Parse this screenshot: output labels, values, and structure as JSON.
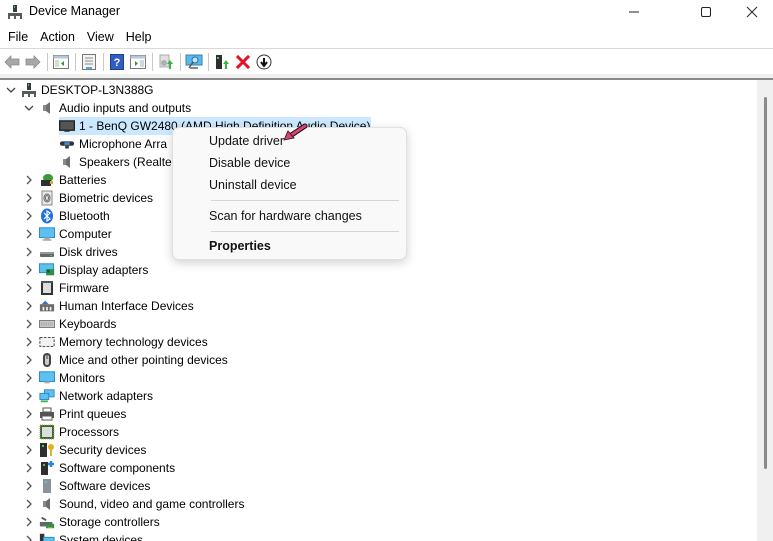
{
  "window": {
    "title": "Device Manager",
    "controls": {
      "minimize": "minimize",
      "maximize": "maximize",
      "close": "close"
    }
  },
  "menubar": {
    "items": [
      "File",
      "Action",
      "View",
      "Help"
    ]
  },
  "toolbar": {
    "buttons": [
      {
        "name": "back",
        "icon": "back-arrow-icon",
        "enabled": false
      },
      {
        "name": "forward",
        "icon": "forward-arrow-icon",
        "enabled": false
      },
      {
        "name": "show-hide-console-tree",
        "icon": "console-tree-icon"
      },
      {
        "name": "properties",
        "icon": "properties-icon"
      },
      {
        "name": "help",
        "icon": "help-icon"
      },
      {
        "name": "show-hide-action-pane",
        "icon": "action-pane-icon"
      },
      {
        "name": "update-driver",
        "icon": "update-driver-icon",
        "enabled": false
      },
      {
        "name": "scan-hardware",
        "icon": "scan-monitor-icon"
      },
      {
        "name": "enable-device",
        "icon": "enable-device-icon"
      },
      {
        "name": "uninstall-device",
        "icon": "uninstall-x-icon"
      },
      {
        "name": "disable-device",
        "icon": "disable-down-arrow-icon"
      }
    ]
  },
  "tree": {
    "root": {
      "label": "DESKTOP-L3N388G",
      "expanded": true
    },
    "expanded_category": {
      "label": "Audio inputs and outputs",
      "children": [
        {
          "label": "1 - BenQ GW2480 (AMD High Definition Audio Device)",
          "selected": true,
          "icon": "monitor-icon"
        },
        {
          "label": "Microphone Arra",
          "icon": "microphone-icon"
        },
        {
          "label": "Speakers (Realtek",
          "icon": "speaker-icon"
        }
      ]
    },
    "categories": [
      {
        "label": "Batteries",
        "icon": "battery-icon"
      },
      {
        "label": "Biometric devices",
        "icon": "fingerprint-icon"
      },
      {
        "label": "Bluetooth",
        "icon": "bluetooth-icon"
      },
      {
        "label": "Computer",
        "icon": "computer-icon"
      },
      {
        "label": "Disk drives",
        "icon": "disk-drive-icon"
      },
      {
        "label": "Display adapters",
        "icon": "display-adapter-icon"
      },
      {
        "label": "Firmware",
        "icon": "firmware-icon"
      },
      {
        "label": "Human Interface Devices",
        "icon": "hid-icon"
      },
      {
        "label": "Keyboards",
        "icon": "keyboard-icon"
      },
      {
        "label": "Memory technology devices",
        "icon": "memory-icon"
      },
      {
        "label": "Mice and other pointing devices",
        "icon": "mouse-icon"
      },
      {
        "label": "Monitors",
        "icon": "monitor-icon"
      },
      {
        "label": "Network adapters",
        "icon": "network-icon"
      },
      {
        "label": "Print queues",
        "icon": "printer-icon"
      },
      {
        "label": "Processors",
        "icon": "processor-icon"
      },
      {
        "label": "Security devices",
        "icon": "security-key-icon"
      },
      {
        "label": "Software components",
        "icon": "software-component-icon"
      },
      {
        "label": "Software devices",
        "icon": "software-device-icon"
      },
      {
        "label": "Sound, video and game controllers",
        "icon": "speaker-icon"
      },
      {
        "label": "Storage controllers",
        "icon": "storage-controller-icon"
      },
      {
        "label": "System devices",
        "icon": "system-devices-icon"
      }
    ]
  },
  "context_menu": {
    "items": [
      {
        "label": "Update driver"
      },
      {
        "label": "Disable device"
      },
      {
        "label": "Uninstall device"
      },
      {
        "separator": true
      },
      {
        "label": "Scan for hardware changes"
      },
      {
        "separator": true
      },
      {
        "label": "Properties",
        "bold": true
      }
    ],
    "callout": "pink arrow pointing at Update driver"
  },
  "colors": {
    "selection": "#cce8ff",
    "callout_arrow": "#e0407a",
    "uninstall_x": "#e81123"
  }
}
